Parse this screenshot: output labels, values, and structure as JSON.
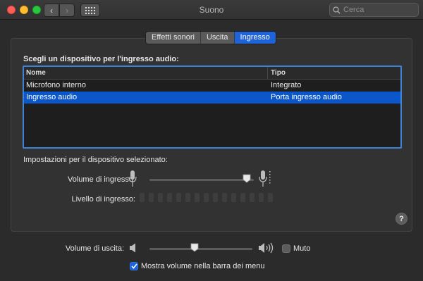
{
  "window": {
    "title": "Suono"
  },
  "search": {
    "placeholder": "Cerca"
  },
  "tabs": [
    {
      "label": "Effetti sonori",
      "active": false
    },
    {
      "label": "Uscita",
      "active": false
    },
    {
      "label": "Ingresso",
      "active": true
    }
  ],
  "panel": {
    "heading": "Scegli un dispositivo per l'ingresso audio:",
    "table": {
      "columns": [
        "Nome",
        "Tipo"
      ],
      "rows": [
        {
          "name": "Microfono interno",
          "type": "Integrato",
          "selected": false
        },
        {
          "name": "Ingresso audio",
          "type": "Porta ingresso audio",
          "selected": true
        }
      ]
    },
    "settings_label": "Impostazioni per il dispositivo selezionato:",
    "input_volume": {
      "label": "Volume di ingresso:",
      "value": 0.93
    },
    "input_level": {
      "label": "Livello di ingresso:",
      "segments": 15,
      "active_segments": 0
    },
    "help": "?"
  },
  "output": {
    "label": "Volume di uscita:",
    "value": 0.44,
    "mute": {
      "label": "Muto",
      "checked": false
    }
  },
  "show_volume": {
    "label": "Mostra volume nella barra dei menu",
    "checked": true
  },
  "colors": {
    "accent": "#1f63d8",
    "selection": "#0b56c9",
    "background": "#2b2b2b"
  }
}
